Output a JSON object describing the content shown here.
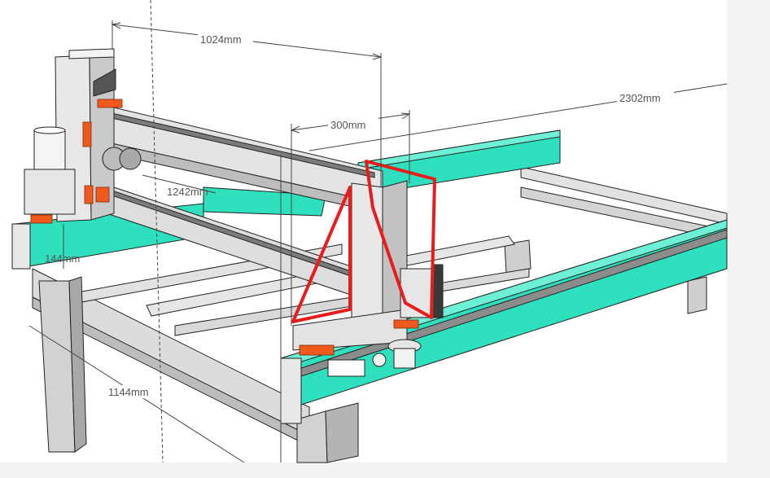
{
  "dimensions": {
    "gantry_span": "1024mm",
    "carriage_width": "300mm",
    "rail_length": "2302mm",
    "cross_span": "1242mm",
    "beam_height": "144mm",
    "frame_width": "1144mm"
  },
  "colors": {
    "background": "#ffffff",
    "frame_gray": "#d6d6d6",
    "frame_light": "#ececec",
    "frame_dark": "#8f8f8f",
    "outline": "#222222",
    "rail_cyan": "#2fe0bf",
    "rail_cyan_dark": "#1fb89c",
    "bracket_orange": "#f05a1e",
    "annotation_red": "#e81c1c",
    "dimension_line": "#444444"
  }
}
